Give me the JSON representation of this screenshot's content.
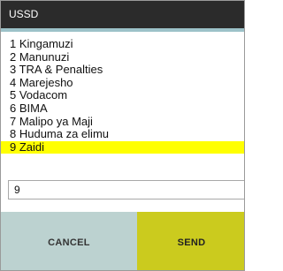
{
  "dialog": {
    "title": "USSD"
  },
  "menu": {
    "items": [
      "1 Kingamuzi",
      "2 Manunuzi",
      "3 TRA & Penalties",
      "4 Marejesho",
      "5 Vodacom",
      "6 BIMA",
      "7 Malipo ya Maji",
      "8 Huduma za elimu",
      "9 Zaidi"
    ],
    "highlighted_index": 8,
    "highlight_color": "#ffff00"
  },
  "input": {
    "value": "9"
  },
  "buttons": {
    "cancel_label": "CANCEL",
    "send_label": "SEND",
    "cancel_color": "#bcd2d0",
    "send_color": "#cbcb1e"
  }
}
